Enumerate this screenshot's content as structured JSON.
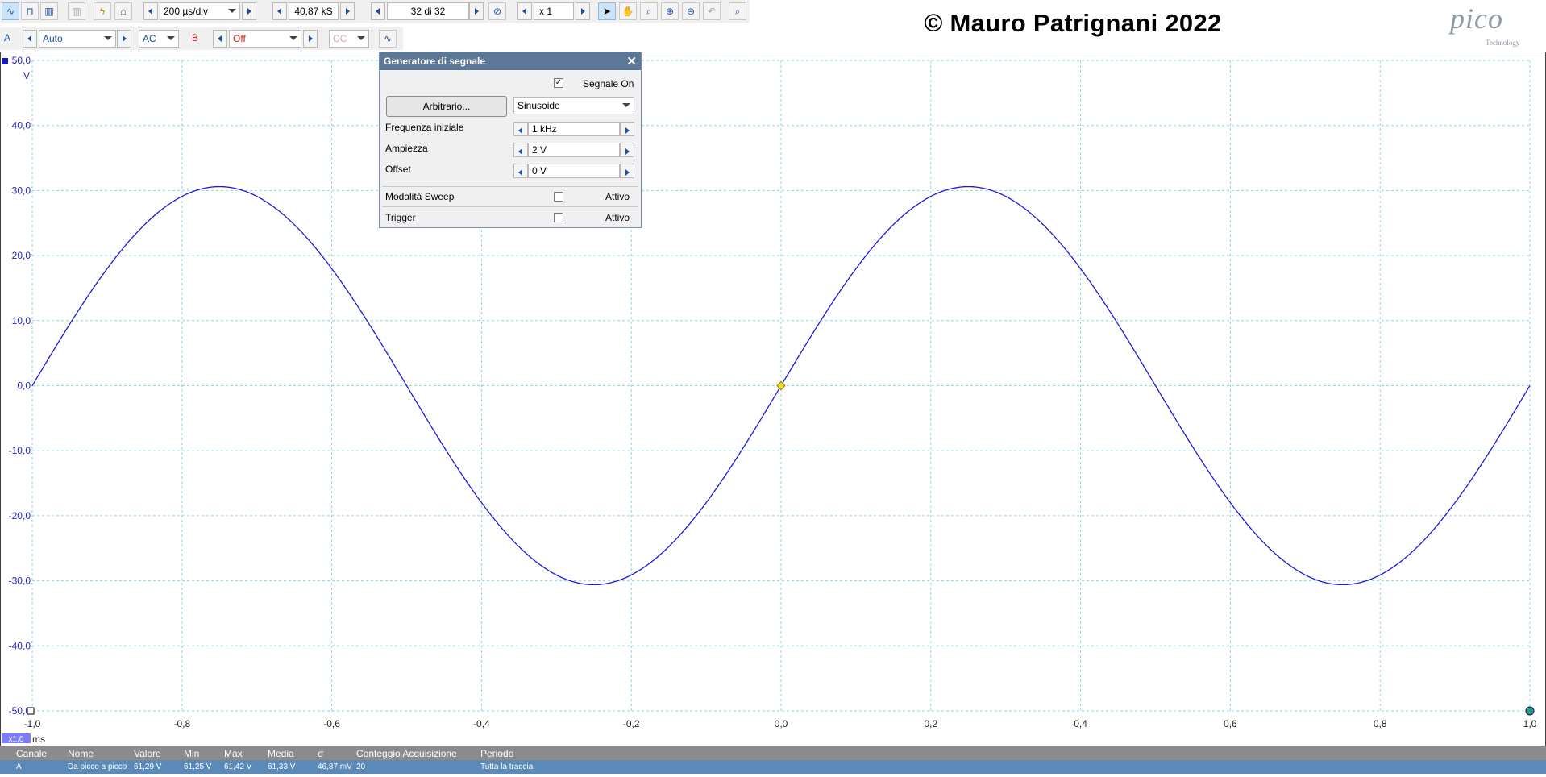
{
  "toolbar1": {
    "timebase": "200 µs/div",
    "samples": "40,87 kS",
    "buffer": "32 di 32",
    "zoom": "x 1"
  },
  "toolbar2": {
    "channel_a": {
      "label": "A",
      "range": "Auto",
      "coupling": "AC"
    },
    "channel_b": {
      "label": "B",
      "range": "Off",
      "coupling": "CC"
    }
  },
  "overlay": {
    "copyright": "© Mauro Patrignani 2022",
    "logo_word": "pico",
    "logo_sub": "Technology"
  },
  "signal_generator": {
    "title": "Generatore di segnale",
    "signal_on_label": "Segnale On",
    "signal_on": true,
    "arbitrary_button": "Arbitrario...",
    "waveform": "Sinusoide",
    "start_freq_label": "Frequenza iniziale",
    "start_freq": "1 kHz",
    "amplitude_label": "Ampiezza",
    "amplitude": "2 V",
    "offset_label": "Offset",
    "offset": "0 V",
    "sweep_label": "Modalità Sweep",
    "sweep_active_label": "Attivo",
    "trigger_label": "Trigger",
    "trigger_active_label": "Attivo"
  },
  "chart_data": {
    "type": "line",
    "xlabel": "ms",
    "ylabel": "V",
    "xlim": [
      -1.0,
      1.0
    ],
    "ylim": [
      -50.0,
      50.0
    ],
    "x_ticks": [
      "-1,0",
      "-0,8",
      "-0,6",
      "-0,4",
      "-0,2",
      "0,0",
      "0,2",
      "0,4",
      "0,6",
      "0,8",
      "1,0"
    ],
    "y_ticks": [
      "50,0",
      "40,0",
      "30,0",
      "20,0",
      "10,0",
      "0,0",
      "-10,0",
      "-20,0",
      "-30,0",
      "-40,0",
      "-50,0"
    ],
    "grid": true,
    "series_color": "#1a1adb",
    "grid_color": "#8fd3e6",
    "series": [
      {
        "frequency_khz": 1.0,
        "amplitude_v": 30.6,
        "offset_v": 0.0,
        "phase_zero_at_ms": 0.0
      }
    ],
    "trigger_marker": {
      "x": 0.0,
      "y": 0.0
    },
    "x_zoom_badge": "x1,0"
  },
  "measurements": {
    "headers": [
      "Canale",
      "Nome",
      "Valore",
      "Min",
      "Max",
      "Media",
      "σ",
      "Conteggio Acquisizione",
      "Periodo"
    ],
    "rows": [
      [
        "A",
        "Da picco a picco",
        "61,29 V",
        "61,25 V",
        "61,42 V",
        "61,33 V",
        "46,87 mV",
        "20",
        "Tutta la traccia"
      ]
    ]
  }
}
